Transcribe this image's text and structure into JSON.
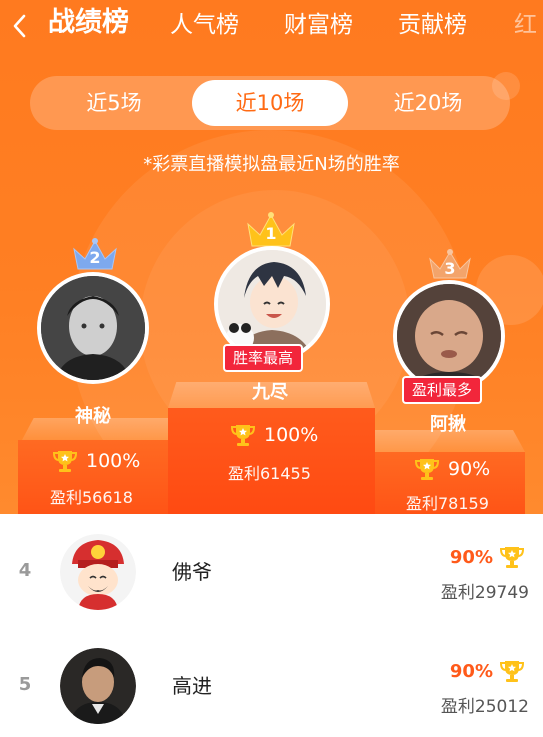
{
  "header": {
    "tabs": [
      {
        "label": "战绩榜",
        "active": true
      },
      {
        "label": "人气榜",
        "active": false
      },
      {
        "label": "财富榜",
        "active": false
      },
      {
        "label": "贡献榜",
        "active": false
      },
      {
        "label": "红",
        "active": false
      }
    ]
  },
  "segment": {
    "options": [
      "近5场",
      "近10场",
      "近20场"
    ],
    "selected": "近10场"
  },
  "note": "*彩票直播模拟盘最近N场的胜率",
  "podium": {
    "first": {
      "rank": "1",
      "name": "九尽",
      "badge": "胜率最高",
      "rate": "100%",
      "profit": "盈利61455"
    },
    "second": {
      "rank": "2",
      "name": "神秘",
      "rate": "100%",
      "profit": "盈利56618"
    },
    "third": {
      "rank": "3",
      "name": "阿揪",
      "badge": "盈利最多",
      "rate": "90%",
      "profit": "盈利78159"
    }
  },
  "list": [
    {
      "rank": "4",
      "name": "佛爷",
      "rate": "90%",
      "profit": "盈利29749"
    },
    {
      "rank": "5",
      "name": "高进",
      "rate": "90%",
      "profit": "盈利25012"
    }
  ],
  "colors": {
    "brand_orange": "#ff7a1f",
    "badge_red": "#f2263b",
    "gold": "#ffc21a",
    "rate_orange": "#ff5a1a"
  },
  "icons": {
    "back": "chevron-left-icon",
    "trophy": "trophy-icon",
    "crown_gold": "crown-gold-icon",
    "crown_silver": "crown-silver-icon",
    "crown_bronze": "crown-bronze-icon"
  }
}
